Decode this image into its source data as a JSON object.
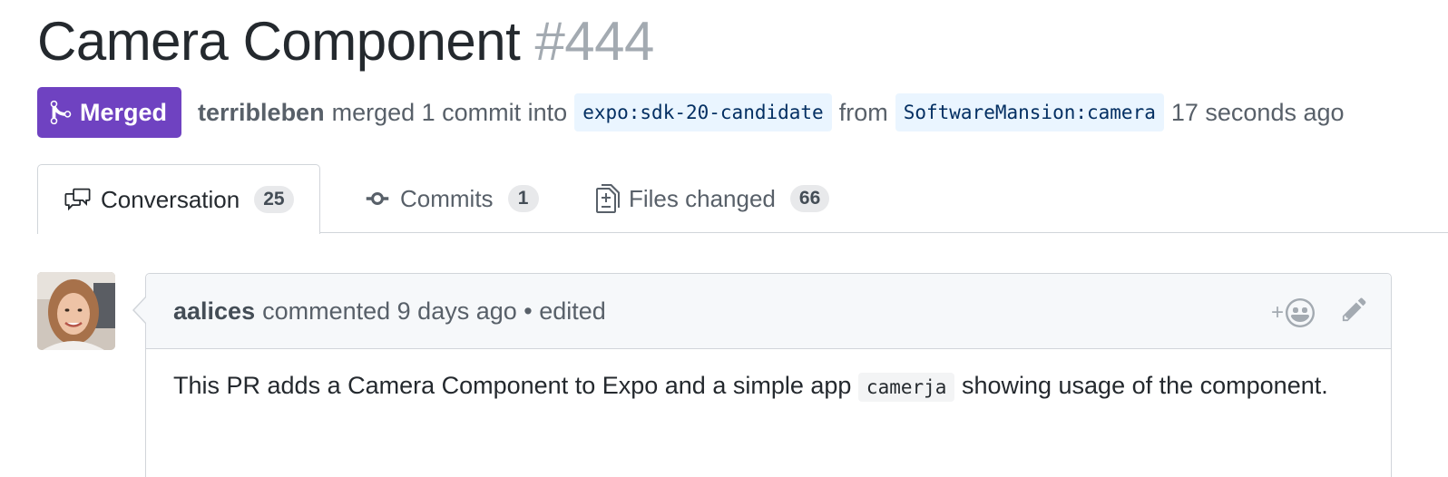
{
  "pr": {
    "title": "Camera Component",
    "number": "#444"
  },
  "meta": {
    "state": "Merged",
    "author": "terribleben",
    "action": "merged 1 commit into",
    "base_ref": "expo:sdk-20-candidate",
    "from_text": "from",
    "head_ref": "SoftwareMansion:camera",
    "time": "17 seconds ago",
    "state_color": "#6f42c1"
  },
  "tabs": [
    {
      "label": "Conversation",
      "count": "25",
      "icon": "comment-discussion-icon",
      "selected": true
    },
    {
      "label": "Commits",
      "count": "1",
      "icon": "git-commit-icon",
      "selected": false
    },
    {
      "label": "Files changed",
      "count": "66",
      "icon": "file-diff-icon",
      "selected": false
    }
  ],
  "comment": {
    "author": "aalices",
    "meta": "commented 9 days ago • edited",
    "body_before": "This PR adds a Camera Component to Expo and a simple app",
    "body_code": "camerja",
    "body_after": "showing usage of the component.",
    "reaction_plus": "+"
  }
}
